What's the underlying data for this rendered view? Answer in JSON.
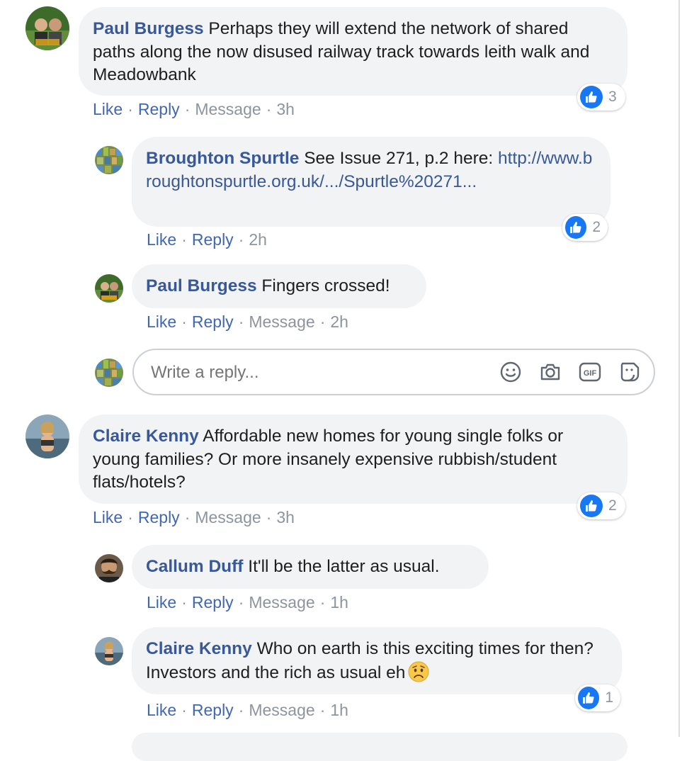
{
  "actions": {
    "like": "Like",
    "reply": "Reply",
    "message": "Message",
    "sep": "·"
  },
  "comments": [
    {
      "author": "Paul Burgess",
      "text": "Perhaps they will extend the network of shared paths along the now disused railway track towards leith walk and Meadowbank",
      "time": "3h",
      "likes": "3"
    },
    {
      "author": "Broughton Spurtle",
      "text": "See Issue 271, p.2 here:",
      "link": "http://www.broughtonspurtle.org.uk/.../Spurtle%20271...",
      "time": "2h",
      "likes": "2"
    },
    {
      "author": "Paul Burgess",
      "text": "Fingers crossed!",
      "time": "2h"
    },
    {
      "author": "Claire Kenny",
      "text": "Affordable new homes for young single folks or young families? Or more insanely expensive rubbish/student flats/hotels?",
      "time": "3h",
      "likes": "2"
    },
    {
      "author": "Callum Duff",
      "text": "It'll be the latter as usual.",
      "time": "1h"
    },
    {
      "author": "Claire Kenny",
      "text": "Who on earth is this exciting times for then? Investors and the rich as usual eh",
      "emoji": "worried-face-emoji",
      "time": "1h",
      "likes": "1"
    }
  ],
  "reply_box": {
    "placeholder": "Write a reply...",
    "tools": [
      "emoji-icon",
      "camera-icon",
      "gif-icon",
      "sticker-icon"
    ],
    "gif_label": "GIF"
  },
  "colors": {
    "link": "#385898",
    "action": "#4267b2",
    "muted": "#8d949e",
    "bubble": "#f2f3f5",
    "like_blue": "#1877f2"
  }
}
